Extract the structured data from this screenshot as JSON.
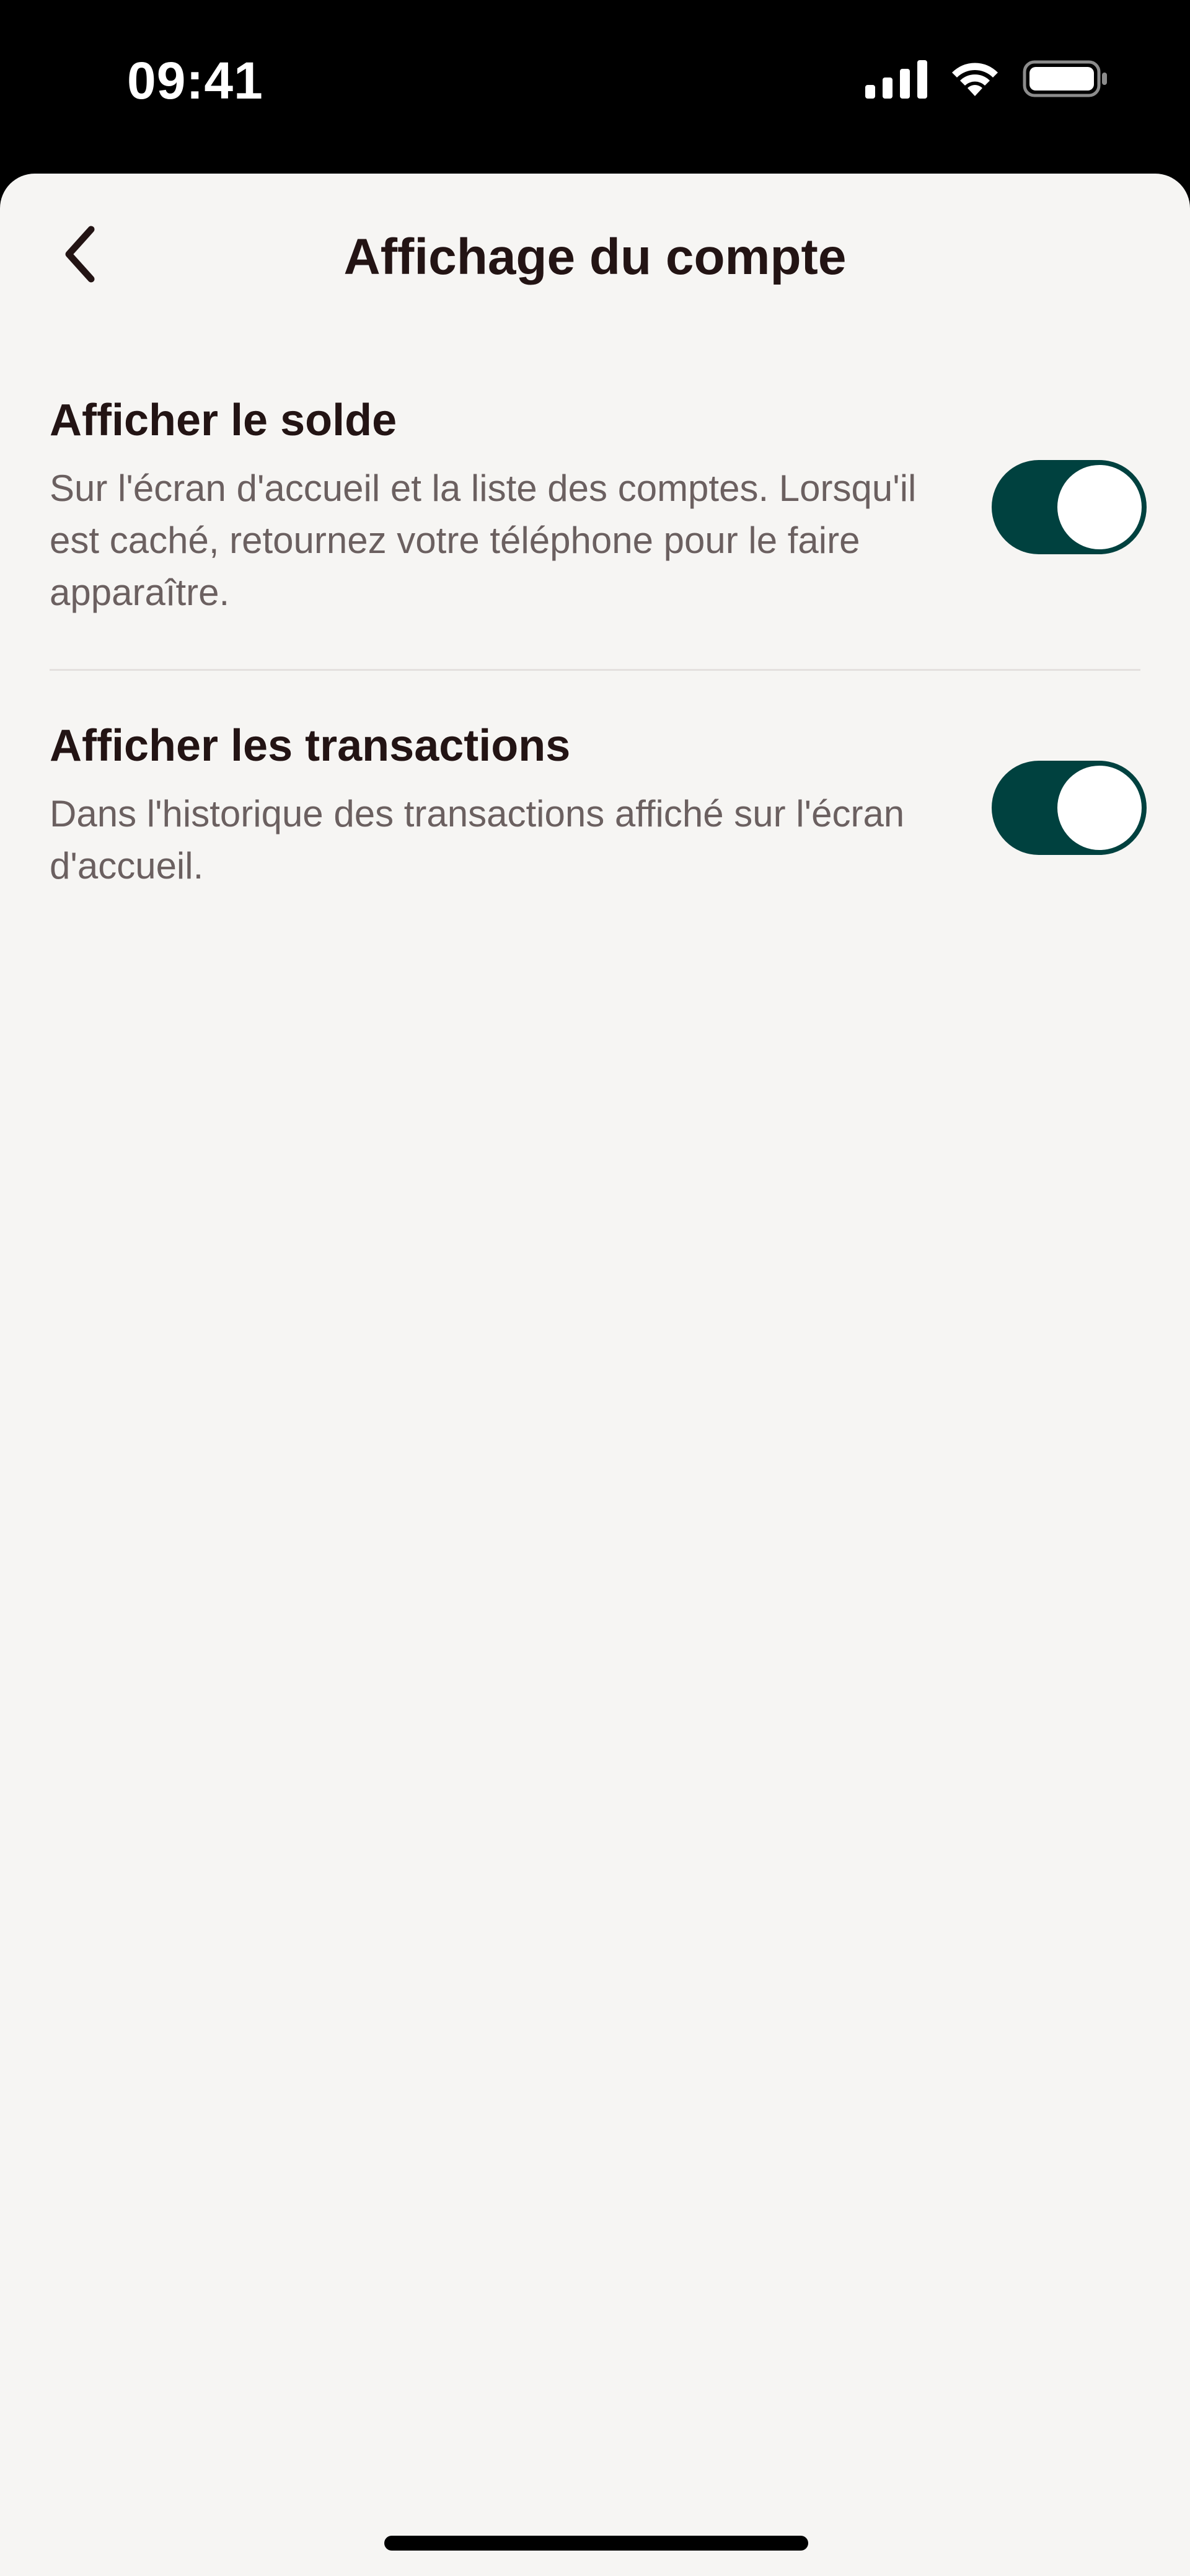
{
  "status_bar": {
    "time": "09:41",
    "icons": [
      "cellular-signal-icon",
      "wifi-icon",
      "battery-icon"
    ]
  },
  "header": {
    "title": "Affichage du compte",
    "back_icon": "chevron-left-icon"
  },
  "settings": [
    {
      "title": "Afficher le solde",
      "description": "Sur l'écran d'accueil et la liste des comptes. Lorsqu'il est caché, retournez votre téléphone pour le faire apparaître.",
      "enabled": true
    },
    {
      "title": "Afficher les transactions",
      "description": "Dans l'historique des transactions affiché sur l'écran d'accueil.",
      "enabled": true
    }
  ],
  "colors": {
    "toggle_on": "#00413f",
    "text_primary": "#231414",
    "text_secondary": "#6b6060",
    "background": "#f6f5f3"
  }
}
